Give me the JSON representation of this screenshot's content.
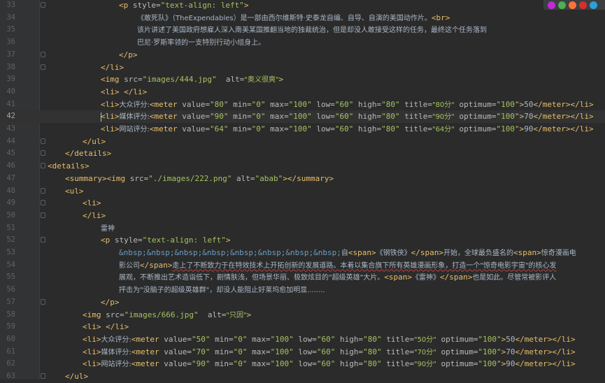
{
  "browser_icons": [
    {
      "name": "intellij-icon",
      "color": "#c22ad8"
    },
    {
      "name": "chrome-icon",
      "color": "#4caf50"
    },
    {
      "name": "firefox-icon",
      "color": "#ff7139"
    },
    {
      "name": "opera-icon",
      "color": "#d32f2f"
    },
    {
      "name": "edge-icon",
      "color": "#2f9fd8"
    }
  ],
  "lines": [
    {
      "n": "33",
      "fold": true,
      "indent": 170,
      "segs": [
        [
          "t",
          "<p"
        ],
        [
          "a",
          " style="
        ],
        [
          "v",
          "\"text-align: left\""
        ],
        [
          "t",
          ">"
        ]
      ]
    },
    {
      "n": "34",
      "fold": false,
      "indent": 196,
      "segs": [
        [
          "x",
          "《敢死队》（TheExpendables）是一部由西尔维斯特·史泰龙自编、自导、自演的美国动作片。"
        ],
        [
          "t",
          "<br>"
        ]
      ]
    },
    {
      "n": "35",
      "fold": false,
      "indent": 196,
      "segs": [
        [
          "x",
          "该片讲述了美国政府想雇人深入南美某国推翻当地的独裁统治，但是却没人敢接受这样的任务，最终这个任务落到"
        ]
      ]
    },
    {
      "n": "36",
      "fold": false,
      "indent": 196,
      "segs": [
        [
          "x",
          "巴尼·罗斯率领的一支特别行动小组身上。"
        ]
      ]
    },
    {
      "n": "37",
      "fold": true,
      "indent": 170,
      "segs": [
        [
          "t",
          "</p>"
        ]
      ]
    },
    {
      "n": "38",
      "fold": true,
      "indent": 144,
      "segs": [
        [
          "t",
          "</li>"
        ]
      ]
    },
    {
      "n": "39",
      "fold": false,
      "indent": 144,
      "segs": [
        [
          "t",
          "<img"
        ],
        [
          "a",
          " src="
        ],
        [
          "v",
          "\"images/444.jpg\""
        ],
        [
          "a",
          "  alt="
        ],
        [
          "v",
          "\"奥义很爽\""
        ],
        [
          "t",
          ">"
        ]
      ]
    },
    {
      "n": "40",
      "fold": false,
      "indent": 144,
      "segs": [
        [
          "t",
          "<li>"
        ],
        [
          "x",
          " "
        ],
        [
          "t",
          "</li>"
        ]
      ]
    },
    {
      "n": "41",
      "fold": false,
      "indent": 144,
      "segs": [
        [
          "t",
          "<li>"
        ],
        [
          "x",
          "大众评分:"
        ],
        [
          "t",
          "<meter"
        ],
        [
          "a",
          " value="
        ],
        [
          "v",
          "\"80\""
        ],
        [
          "a",
          " min="
        ],
        [
          "v",
          "\"0\""
        ],
        [
          "a",
          " max="
        ],
        [
          "v",
          "\"100\""
        ],
        [
          "a",
          " low="
        ],
        [
          "v",
          "\"60\""
        ],
        [
          "a",
          " high="
        ],
        [
          "v",
          "\"80\""
        ],
        [
          "a",
          " title="
        ],
        [
          "v",
          "\"80分\""
        ],
        [
          "a",
          " optimum="
        ],
        [
          "v",
          "\"100\""
        ],
        [
          "t",
          ">"
        ],
        [
          "x",
          "50"
        ],
        [
          "t",
          "</meter></li>"
        ]
      ]
    },
    {
      "n": "42",
      "fold": false,
      "indent": 144,
      "current": true,
      "segs": [
        [
          "c",
          ""
        ],
        [
          "t",
          "<li>"
        ],
        [
          "x",
          "媒体评分:"
        ],
        [
          "t",
          "<meter"
        ],
        [
          "a",
          " value="
        ],
        [
          "v",
          "\"90\""
        ],
        [
          "a",
          " min="
        ],
        [
          "v",
          "\"0\""
        ],
        [
          "a",
          " max="
        ],
        [
          "v",
          "\"100\""
        ],
        [
          "a",
          " low="
        ],
        [
          "v",
          "\"60\""
        ],
        [
          "a",
          " high="
        ],
        [
          "v",
          "\"80\""
        ],
        [
          "a",
          " title="
        ],
        [
          "v",
          "\"90分\""
        ],
        [
          "a",
          " optimum="
        ],
        [
          "v",
          "\"100\""
        ],
        [
          "t",
          ">"
        ],
        [
          "x",
          "70"
        ],
        [
          "t",
          "</meter></li>"
        ]
      ]
    },
    {
      "n": "43",
      "fold": false,
      "indent": 144,
      "segs": [
        [
          "t",
          "<li>"
        ],
        [
          "x",
          "网站评分:"
        ],
        [
          "t",
          "<meter"
        ],
        [
          "a",
          " value="
        ],
        [
          "v",
          "\"64\""
        ],
        [
          "a",
          " min="
        ],
        [
          "v",
          "\"0\""
        ],
        [
          "a",
          " max="
        ],
        [
          "v",
          "\"100\""
        ],
        [
          "a",
          " low="
        ],
        [
          "v",
          "\"60\""
        ],
        [
          "a",
          " high="
        ],
        [
          "v",
          "\"80\""
        ],
        [
          "a",
          " title="
        ],
        [
          "v",
          "\"64分\""
        ],
        [
          "a",
          " optimum="
        ],
        [
          "v",
          "\"100\""
        ],
        [
          "t",
          ">"
        ],
        [
          "x",
          "90"
        ],
        [
          "t",
          "</meter></li>"
        ]
      ]
    },
    {
      "n": "44",
      "fold": true,
      "indent": 118,
      "segs": [
        [
          "t",
          "</ul>"
        ]
      ]
    },
    {
      "n": "45",
      "fold": true,
      "indent": 93,
      "segs": [
        [
          "t",
          "</details>"
        ]
      ]
    },
    {
      "n": "46",
      "fold": true,
      "indent": 68,
      "segs": [
        [
          "t",
          "<details>"
        ]
      ]
    },
    {
      "n": "47",
      "fold": false,
      "indent": 93,
      "segs": [
        [
          "t",
          "<summary><img"
        ],
        [
          "a",
          " src="
        ],
        [
          "v",
          "\"./images/222.png\""
        ],
        [
          "a",
          " alt="
        ],
        [
          "v",
          "\"abab\""
        ],
        [
          "t",
          "></summary>"
        ]
      ]
    },
    {
      "n": "48",
      "fold": true,
      "indent": 93,
      "segs": [
        [
          "t",
          "<ul>"
        ]
      ]
    },
    {
      "n": "49",
      "fold": true,
      "indent": 118,
      "segs": [
        [
          "t",
          "<li>"
        ]
      ]
    },
    {
      "n": "50",
      "fold": true,
      "indent": 118,
      "segs": [
        [
          "t",
          "</li>"
        ]
      ]
    },
    {
      "n": "51",
      "fold": false,
      "indent": 144,
      "segs": [
        [
          "x",
          "雷神"
        ]
      ]
    },
    {
      "n": "52",
      "fold": true,
      "indent": 144,
      "segs": [
        [
          "t",
          "<p"
        ],
        [
          "a",
          " style="
        ],
        [
          "v",
          "\"text-align: left\""
        ],
        [
          "t",
          ">"
        ]
      ]
    },
    {
      "n": "53",
      "fold": false,
      "indent": 170,
      "segs": [
        [
          "e",
          "&nbsp;&nbsp;&nbsp;&nbsp;&nbsp;&nbsp;&nbsp;&nbsp;"
        ],
        [
          "x",
          "自"
        ],
        [
          "t",
          "<span>"
        ],
        [
          "x",
          "《钢铁侠》"
        ],
        [
          "t",
          "</span>"
        ],
        [
          "x",
          "开始，全球最负盛名的"
        ],
        [
          "t",
          "<span>"
        ],
        [
          "x",
          "惊奇漫画电"
        ]
      ]
    },
    {
      "n": "54",
      "fold": false,
      "indent": 170,
      "segs": [
        [
          "x",
          "影公司"
        ],
        [
          "t",
          "</span>"
        ],
        [
          "x",
          "走上了不断致力于在特效技术上开拓创新的发展道路。本着以集合旗下所有英雄漫画形象，打造一个\"惊奇电影宇宙\"的核心发"
        ]
      ]
    },
    {
      "n": "55",
      "fold": false,
      "indent": 170,
      "segs": [
        [
          "x",
          "展观，不断推出艺术造诣低下，剧情肤浅，但场景华丽、极致炫目的\"超级英雄\"大片。"
        ],
        [
          "t",
          "<span>"
        ],
        [
          "x",
          "《雷神》"
        ],
        [
          "t",
          "</span>"
        ],
        [
          "x",
          "也是如此。尽管常被影评人"
        ]
      ]
    },
    {
      "n": "56",
      "fold": false,
      "indent": 170,
      "segs": [
        [
          "x",
          "抨击为\"没脑子的超级英雄群\"，却没人能阻止好莱坞愈加明显........"
        ]
      ]
    },
    {
      "n": "57",
      "fold": true,
      "indent": 144,
      "segs": [
        [
          "t",
          "</p>"
        ]
      ]
    },
    {
      "n": "58",
      "fold": false,
      "indent": 118,
      "segs": [
        [
          "t",
          "<img"
        ],
        [
          "a",
          " src="
        ],
        [
          "v",
          "\"images/666.jpg\""
        ],
        [
          "a",
          "  alt="
        ],
        [
          "v",
          "\"只因\""
        ],
        [
          "t",
          ">"
        ]
      ]
    },
    {
      "n": "59",
      "fold": false,
      "indent": 118,
      "segs": [
        [
          "t",
          "<li>"
        ],
        [
          "x",
          " "
        ],
        [
          "t",
          "</li>"
        ]
      ]
    },
    {
      "n": "60",
      "fold": false,
      "indent": 118,
      "segs": [
        [
          "t",
          "<li>"
        ],
        [
          "x",
          "大众评分:"
        ],
        [
          "t",
          "<meter"
        ],
        [
          "a",
          " value="
        ],
        [
          "v",
          "\"50\""
        ],
        [
          "a",
          " min="
        ],
        [
          "v",
          "\"0\""
        ],
        [
          "a",
          " max="
        ],
        [
          "v",
          "\"100\""
        ],
        [
          "a",
          " low="
        ],
        [
          "v",
          "\"60\""
        ],
        [
          "a",
          " high="
        ],
        [
          "v",
          "\"80\""
        ],
        [
          "a",
          " title="
        ],
        [
          "v",
          "\"50分\""
        ],
        [
          "a",
          " optimum="
        ],
        [
          "v",
          "\"100\""
        ],
        [
          "t",
          ">"
        ],
        [
          "x",
          "50"
        ],
        [
          "t",
          "</meter></li>"
        ]
      ]
    },
    {
      "n": "61",
      "fold": false,
      "indent": 118,
      "segs": [
        [
          "t",
          "<li>"
        ],
        [
          "x",
          "媒体评分:"
        ],
        [
          "t",
          "<meter"
        ],
        [
          "a",
          " value="
        ],
        [
          "v",
          "\"70\""
        ],
        [
          "a",
          " min="
        ],
        [
          "v",
          "\"0\""
        ],
        [
          "a",
          " max="
        ],
        [
          "v",
          "\"100\""
        ],
        [
          "a",
          " low="
        ],
        [
          "v",
          "\"60\""
        ],
        [
          "a",
          " high="
        ],
        [
          "v",
          "\"80\""
        ],
        [
          "a",
          " title="
        ],
        [
          "v",
          "\"70分\""
        ],
        [
          "a",
          " optimum="
        ],
        [
          "v",
          "\"100\""
        ],
        [
          "t",
          ">"
        ],
        [
          "x",
          "70"
        ],
        [
          "t",
          "</meter></li>"
        ]
      ]
    },
    {
      "n": "62",
      "fold": false,
      "indent": 118,
      "segs": [
        [
          "t",
          "<li>"
        ],
        [
          "x",
          "网站评分:"
        ],
        [
          "t",
          "<meter"
        ],
        [
          "a",
          " value="
        ],
        [
          "v",
          "\"90\""
        ],
        [
          "a",
          " min="
        ],
        [
          "v",
          "\"0\""
        ],
        [
          "a",
          " max="
        ],
        [
          "v",
          "\"100\""
        ],
        [
          "a",
          " low="
        ],
        [
          "v",
          "\"60\""
        ],
        [
          "a",
          " high="
        ],
        [
          "v",
          "\"80\""
        ],
        [
          "a",
          " title="
        ],
        [
          "v",
          "\"90分\""
        ],
        [
          "a",
          " optimum="
        ],
        [
          "v",
          "\"100\""
        ],
        [
          "t",
          ">"
        ],
        [
          "x",
          "90"
        ],
        [
          "t",
          "</meter></li>"
        ]
      ]
    },
    {
      "n": "63",
      "fold": true,
      "indent": 93,
      "segs": [
        [
          "t",
          "</ul>"
        ]
      ]
    }
  ]
}
